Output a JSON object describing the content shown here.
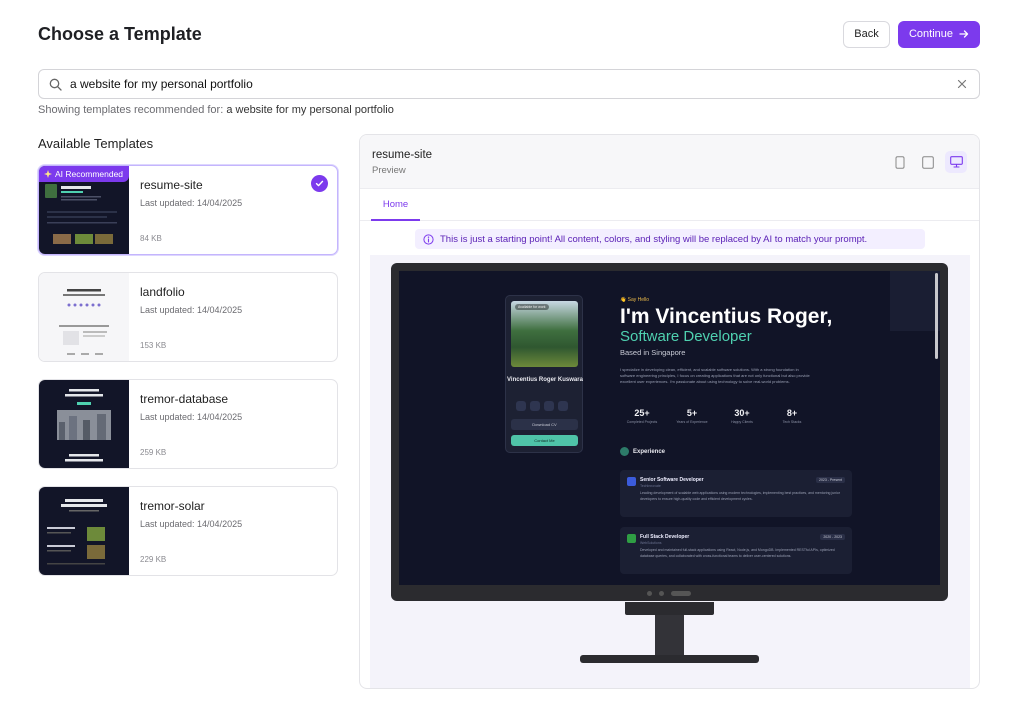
{
  "page": {
    "title": "Choose a Template",
    "back_label": "Back",
    "continue_label": "Continue"
  },
  "search": {
    "value": "a website for my personal portfolio",
    "hint_prefix": "Showing templates recommended for:",
    "hint_query": "a website for my personal portfolio"
  },
  "templates": {
    "section_title": "Available Templates",
    "ai_badge": "AI Recommended",
    "items": [
      {
        "name": "resume-site",
        "updated": "Last updated: 14/04/2025",
        "size": "84 KB"
      },
      {
        "name": "landfolio",
        "updated": "Last updated: 14/04/2025",
        "size": "153 KB"
      },
      {
        "name": "tremor-database",
        "updated": "Last updated: 14/04/2025",
        "size": "259 KB"
      },
      {
        "name": "tremor-solar",
        "updated": "Last updated: 14/04/2025",
        "size": "229 KB"
      }
    ]
  },
  "preview": {
    "title": "resume-site",
    "subtitle": "Preview",
    "tab_home": "Home",
    "notice": "This is just a starting point! All content, colors, and styling will be replaced by AI to match your prompt.",
    "site": {
      "available": "Available for work",
      "name": "Vincentius Roger Kuswara",
      "download_cv": "Download CV",
      "contact": "Contact Me",
      "say_hello": "👋 Say Hello",
      "headline": "I'm Vincentius Roger,",
      "role": "Software Developer",
      "location": "Based in Singapore",
      "bio": "I specialize in developing clean, efficient, and scalable software solutions. With a strong foundation in software engineering principles, I focus on creating applications that are not only functional but also provide excellent user experiences. I'm passionate about using technology to solve real-world problems.",
      "stats": [
        {
          "value": "25+",
          "label": "Completed Projects"
        },
        {
          "value": "5+",
          "label": "Years of Experience"
        },
        {
          "value": "30+",
          "label": "Happy Clients"
        },
        {
          "value": "8+",
          "label": "Tech Stacks"
        }
      ],
      "experience_title": "Experience",
      "experience": [
        {
          "title": "Senior Software Developer",
          "company": "TechInnovate",
          "dates": "2023 - Present",
          "text": "Leading development of scalable web applications using modern technologies, implementing best practices, and mentoring junior developers to ensure high-quality code and efficient development cycles."
        },
        {
          "title": "Full Stack Developer",
          "company": "WebSolutions",
          "dates": "2020 - 2023",
          "text": "Developed and maintained full-stack applications using React, Node.js, and MongoDB. Implemented RESTful APIs, optimized database queries, and collaborated with cross-functional teams to deliver user-centered solutions."
        }
      ]
    }
  },
  "colors": {
    "accent": "#7c3aed",
    "teal": "#4fd1b0"
  }
}
